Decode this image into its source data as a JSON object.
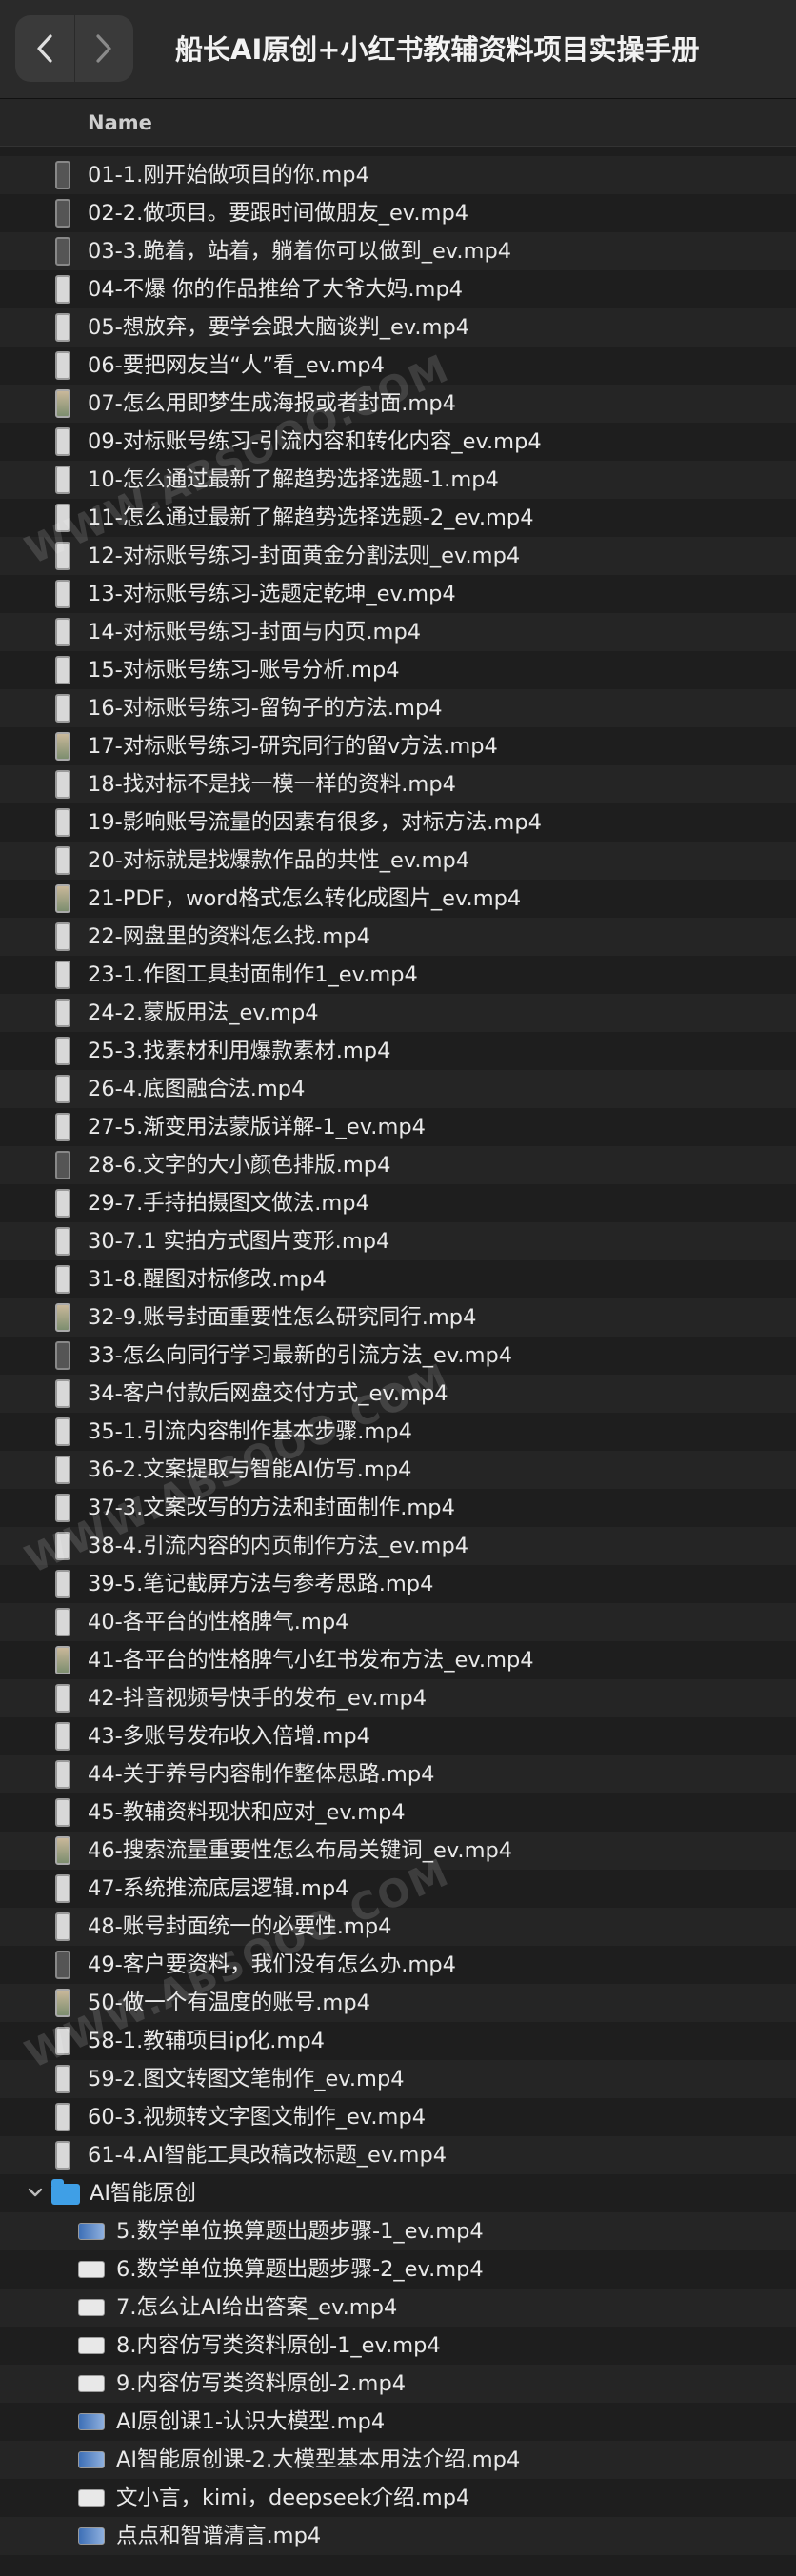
{
  "window": {
    "title": "船长AI原创+小红书教辅资料项目实操手册",
    "back_icon": "chevron-left-icon",
    "forward_icon": "chevron-right-icon"
  },
  "table": {
    "column_name": "Name"
  },
  "files": [
    {
      "name": "01-1.刚开始做项目的你.mp4",
      "icon": "dark"
    },
    {
      "name": "02-2.做项目。要跟时间做朋友_ev.mp4",
      "icon": "dark"
    },
    {
      "name": "03-3.跪着，站着，躺着你可以做到_ev.mp4",
      "icon": "dark"
    },
    {
      "name": "04-不爆 你的作品推给了大爷大妈.mp4",
      "icon": "phone"
    },
    {
      "name": "05-想放弃，要学会跟大脑谈判_ev.mp4",
      "icon": "phone"
    },
    {
      "name": "06-要把网友当“人”看_ev.mp4",
      "icon": "phone"
    },
    {
      "name": "07-怎么用即梦生成海报或者封面.mp4",
      "icon": "color"
    },
    {
      "name": "09-对标账号练习-引流内容和转化内容_ev.mp4",
      "icon": "phone"
    },
    {
      "name": "10-怎么通过最新了解趋势选择选题-1.mp4",
      "icon": "phone"
    },
    {
      "name": "11-怎么通过最新了解趋势选择选题-2_ev.mp4",
      "icon": "phone"
    },
    {
      "name": "12-对标账号练习-封面黄金分割法则_ev.mp4",
      "icon": "phone"
    },
    {
      "name": "13-对标账号练习-选题定乾坤_ev.mp4",
      "icon": "phone"
    },
    {
      "name": "14-对标账号练习-封面与内页.mp4",
      "icon": "phone"
    },
    {
      "name": "15-对标账号练习-账号分析.mp4",
      "icon": "phone"
    },
    {
      "name": "16-对标账号练习-留钩子的方法.mp4",
      "icon": "phone"
    },
    {
      "name": "17-对标账号练习-研究同行的留v方法.mp4",
      "icon": "color"
    },
    {
      "name": "18-找对标不是找一模一样的资料.mp4",
      "icon": "phone"
    },
    {
      "name": "19-影响账号流量的因素有很多，对标方法.mp4",
      "icon": "phone"
    },
    {
      "name": "20-对标就是找爆款作品的共性_ev.mp4",
      "icon": "phone"
    },
    {
      "name": "21-PDF，word格式怎么转化成图片_ev.mp4",
      "icon": "color"
    },
    {
      "name": "22-网盘里的资料怎么找.mp4",
      "icon": "phone"
    },
    {
      "name": "23-1.作图工具封面制作1_ev.mp4",
      "icon": "phone"
    },
    {
      "name": "24-2.蒙版用法_ev.mp4",
      "icon": "phone"
    },
    {
      "name": "25-3.找素材利用爆款素材.mp4",
      "icon": "phone"
    },
    {
      "name": "26-4.底图融合法.mp4",
      "icon": "phone"
    },
    {
      "name": "27-5.渐变用法蒙版详解-1_ev.mp4",
      "icon": "phone"
    },
    {
      "name": "28-6.文字的大小颜色排版.mp4",
      "icon": "dark"
    },
    {
      "name": "29-7.手持拍摄图文做法.mp4",
      "icon": "phone"
    },
    {
      "name": "30-7.1 实拍方式图片变形.mp4",
      "icon": "phone"
    },
    {
      "name": "31-8.醒图对标修改.mp4",
      "icon": "phone"
    },
    {
      "name": "32-9.账号封面重要性怎么研究同行.mp4",
      "icon": "color"
    },
    {
      "name": "33-怎么向同行学习最新的引流方法_ev.mp4",
      "icon": "dark"
    },
    {
      "name": "34-客户付款后网盘交付方式_ev.mp4",
      "icon": "phone"
    },
    {
      "name": "35-1.引流内容制作基本步骤.mp4",
      "icon": "phone"
    },
    {
      "name": "36-2.文案提取与智能AI仿写.mp4",
      "icon": "phone"
    },
    {
      "name": "37-3.文案改写的方法和封面制作.mp4",
      "icon": "phone"
    },
    {
      "name": "38-4.引流内容的内页制作方法_ev.mp4",
      "icon": "phone"
    },
    {
      "name": "39-5.笔记截屏方法与参考思路.mp4",
      "icon": "phone"
    },
    {
      "name": "40-各平台的性格脾气.mp4",
      "icon": "phone"
    },
    {
      "name": "41-各平台的性格脾气小红书发布方法_ev.mp4",
      "icon": "color"
    },
    {
      "name": "42-抖音视频号快手的发布_ev.mp4",
      "icon": "phone"
    },
    {
      "name": "43-多账号发布收入倍增.mp4",
      "icon": "phone"
    },
    {
      "name": "44-关于养号内容制作整体思路.mp4",
      "icon": "phone"
    },
    {
      "name": "45-教辅资料现状和应对_ev.mp4",
      "icon": "phone"
    },
    {
      "name": "46-搜索流量重要性怎么布局关键词_ev.mp4",
      "icon": "color"
    },
    {
      "name": "47-系统推流底层逻辑.mp4",
      "icon": "phone"
    },
    {
      "name": "48-账号封面统一的必要性.mp4",
      "icon": "phone"
    },
    {
      "name": "49-客户要资料，我们没有怎么办.mp4",
      "icon": "dark"
    },
    {
      "name": "50-做一个有温度的账号.mp4",
      "icon": "color"
    },
    {
      "name": "58-1.教辅项目ip化.mp4",
      "icon": "phone"
    },
    {
      "name": "59-2.图文转图文笔制作_ev.mp4",
      "icon": "phone"
    },
    {
      "name": "60-3.视频转文字图文制作_ev.mp4",
      "icon": "phone"
    },
    {
      "name": "61-4.AI智能工具改稿改标题_ev.mp4",
      "icon": "phone"
    }
  ],
  "folder": {
    "name": "AI智能原创",
    "icon": "folder-icon",
    "disclosure_icon": "chevron-down-icon",
    "files": [
      {
        "name": "5.数学单位换算题出题步骤-1_ev.mp4",
        "icon": "blue"
      },
      {
        "name": "6.数学单位换算题出题步骤-2_ev.mp4",
        "icon": "plain"
      },
      {
        "name": "7.怎么让AI给出答案_ev.mp4",
        "icon": "plain"
      },
      {
        "name": "8.内容仿写类资料原创-1_ev.mp4",
        "icon": "plain"
      },
      {
        "name": "9.内容仿写类资料原创-2.mp4",
        "icon": "plain"
      },
      {
        "name": "AI原创课1-认识大模型.mp4",
        "icon": "blue"
      },
      {
        "name": "AI智能原创课-2.大模型基本用法介绍.mp4",
        "icon": "blue"
      },
      {
        "name": "文小言，kimi，deepseek介绍.mp4",
        "icon": "plain"
      },
      {
        "name": "点点和智谱清言.mp4",
        "icon": "blue"
      }
    ]
  },
  "watermarks": [
    "WWW.ABSOOO.COM",
    "WWW.ABSOOO.COM",
    "WWW.ABSOOO.COM"
  ]
}
